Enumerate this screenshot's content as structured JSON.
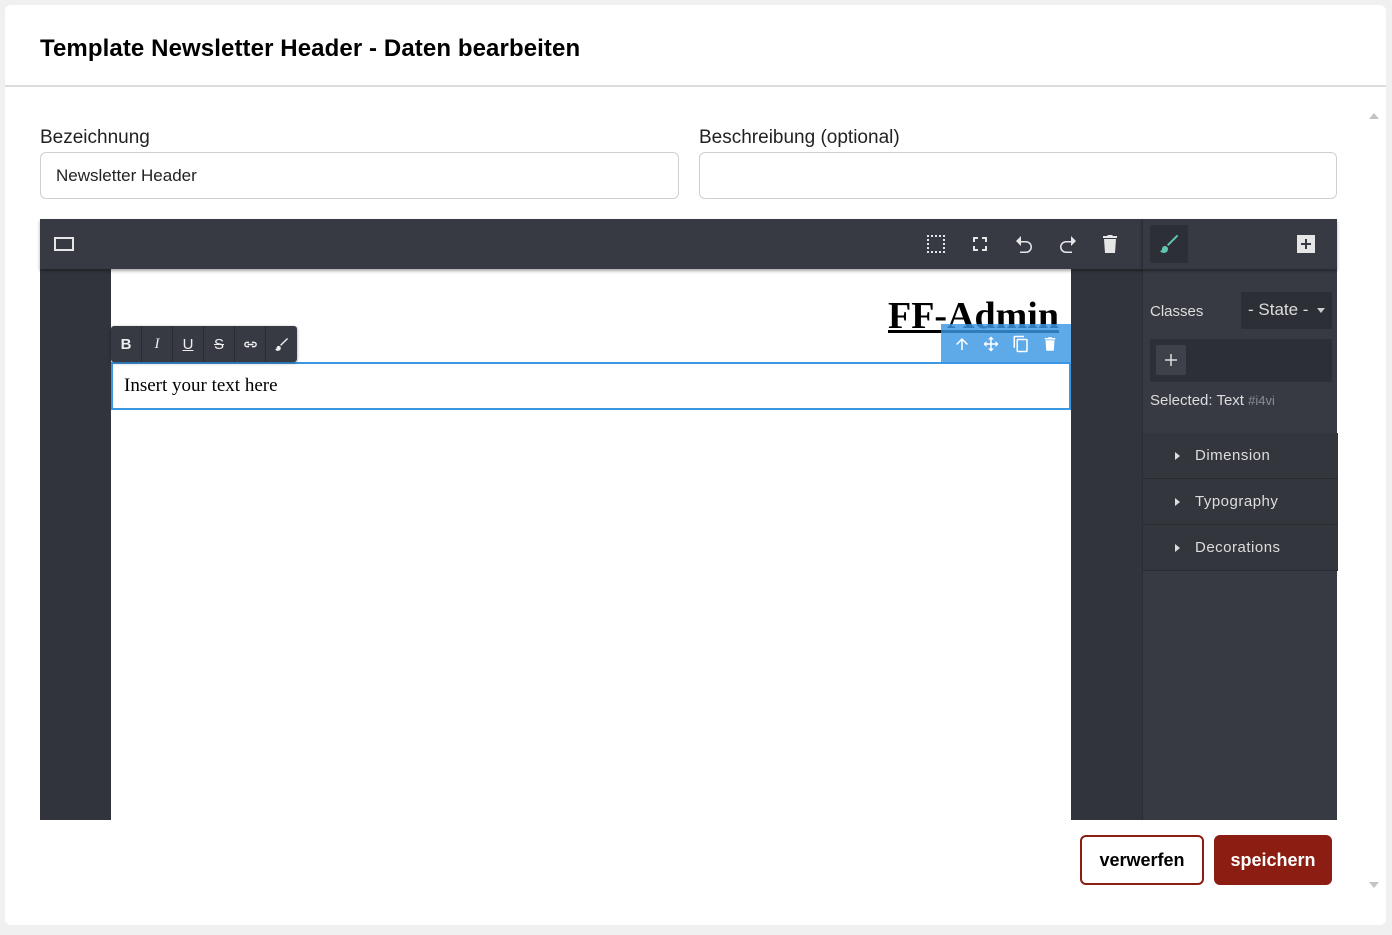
{
  "modal": {
    "title": "Template Newsletter Header - Daten bearbeiten"
  },
  "form": {
    "name_label": "Bezeichnung",
    "name_value": "Newsletter Header",
    "description_label": "Beschreibung (optional)",
    "description_value": ""
  },
  "editor": {
    "canvas": {
      "heading_text": "FF-Admin",
      "text_block": "Insert your text here"
    },
    "rte_toolbar": {
      "bold": "B",
      "italic": "I",
      "underline": "U",
      "strikethrough": "S"
    },
    "style_manager": {
      "classes_label": "Classes",
      "state_value": "- State -",
      "selected_label": "Selected:",
      "selected_component": "Text",
      "selected_id": "#i4vi",
      "sectors": [
        "Dimension",
        "Typography",
        "Decorations"
      ]
    }
  },
  "footer": {
    "discard_label": "verwerfen",
    "save_label": "speichern"
  },
  "colors": {
    "brand_red": "#8b1d12",
    "editor_dark": "#373a42",
    "selection_blue": "#3b97e3",
    "brush_accent": "#62c4b0"
  }
}
